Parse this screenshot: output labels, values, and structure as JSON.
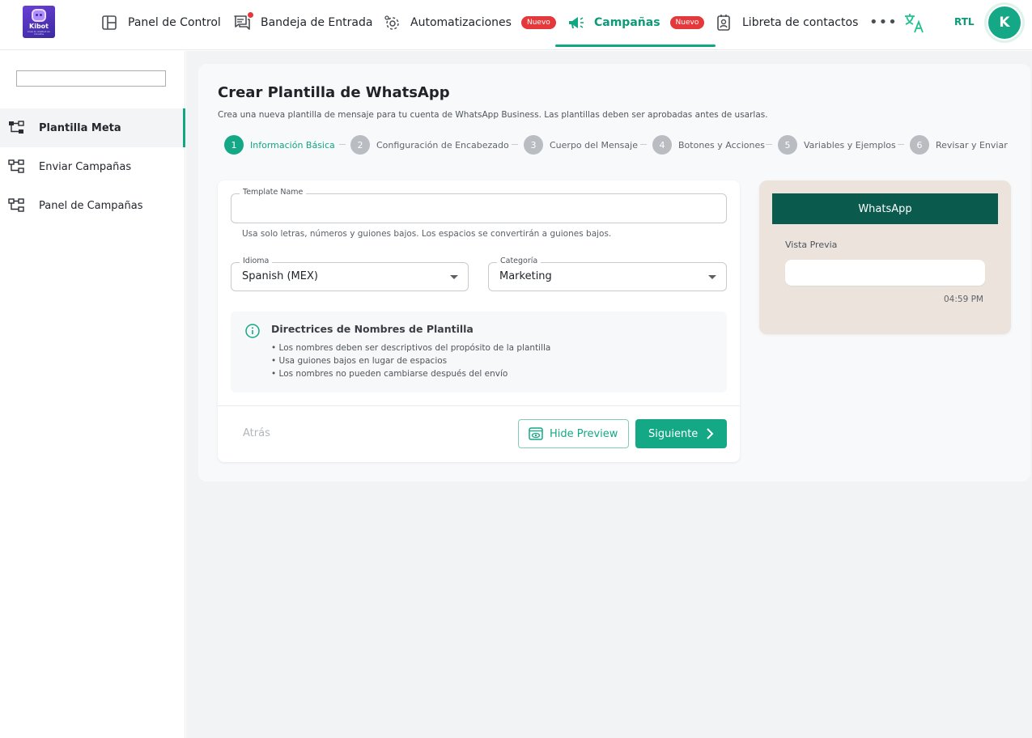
{
  "logo": {
    "name": "Kibot",
    "tagline": "Crea tu chatbot en minutos"
  },
  "nav": {
    "items": [
      {
        "label": "Panel de Control",
        "icon": "layout-icon"
      },
      {
        "label": "Bandeja de Entrada",
        "icon": "inbox-icon",
        "has_notification_dot": true
      },
      {
        "label": "Automatizaciones",
        "icon": "gear-icon",
        "badge": "Nuevo"
      },
      {
        "label": "Campañas",
        "icon": "megaphone-icon",
        "badge": "Nuevo",
        "active": true
      },
      {
        "label": "Libreta de contactos",
        "icon": "contact-book-icon"
      }
    ],
    "rtl_label": "RTL",
    "avatar_initial": "K"
  },
  "sidebar": {
    "items": [
      {
        "label": "Plantilla Meta",
        "icon": "hierarchy-icon",
        "active": true
      },
      {
        "label": "Enviar Campañas",
        "icon": "hierarchy-icon"
      },
      {
        "label": "Panel de Campañas",
        "icon": "hierarchy-icon"
      }
    ]
  },
  "page": {
    "title": "Crear Plantilla de WhatsApp",
    "description": "Crea una nueva plantilla de mensaje para tu cuenta de WhatsApp Business. Las plantillas deben ser aprobadas antes de usarlas."
  },
  "steps": [
    {
      "num": "1",
      "label": "Información Básica",
      "active": true
    },
    {
      "num": "2",
      "label": "Configuración de Encabezado"
    },
    {
      "num": "3",
      "label": "Cuerpo del Mensaje"
    },
    {
      "num": "4",
      "label": "Botones y Acciones"
    },
    {
      "num": "5",
      "label": "Variables y Ejemplos"
    },
    {
      "num": "6",
      "label": "Revisar y Enviar"
    }
  ],
  "form": {
    "template_name": {
      "label": "Template Name",
      "value": "",
      "helper": "Usa solo letras, números y guiones bajos. Los espacios se convertirán a guiones bajos."
    },
    "language": {
      "label": "Idioma",
      "value": "Spanish (MEX)"
    },
    "category": {
      "label": "Categoría",
      "value": "Marketing"
    }
  },
  "guidelines": {
    "title": "Directrices de Nombres de Plantilla",
    "lines": [
      "• Los nombres deben ser descriptivos del propósito de la plantilla",
      "• Usa guiones bajos en lugar de espacios",
      "• Los nombres no pueden cambiarse después del envío"
    ]
  },
  "actions": {
    "back": "Atrás",
    "hide_preview": "Hide Preview",
    "next": "Siguiente"
  },
  "preview": {
    "header": "WhatsApp",
    "label": "Vista Previa",
    "time": "04:59 PM"
  },
  "colors": {
    "accent": "#15a886",
    "badge": "#e5383b",
    "whatsapp_header": "#0a5b4e",
    "preview_bg": "#ebe3dc"
  }
}
